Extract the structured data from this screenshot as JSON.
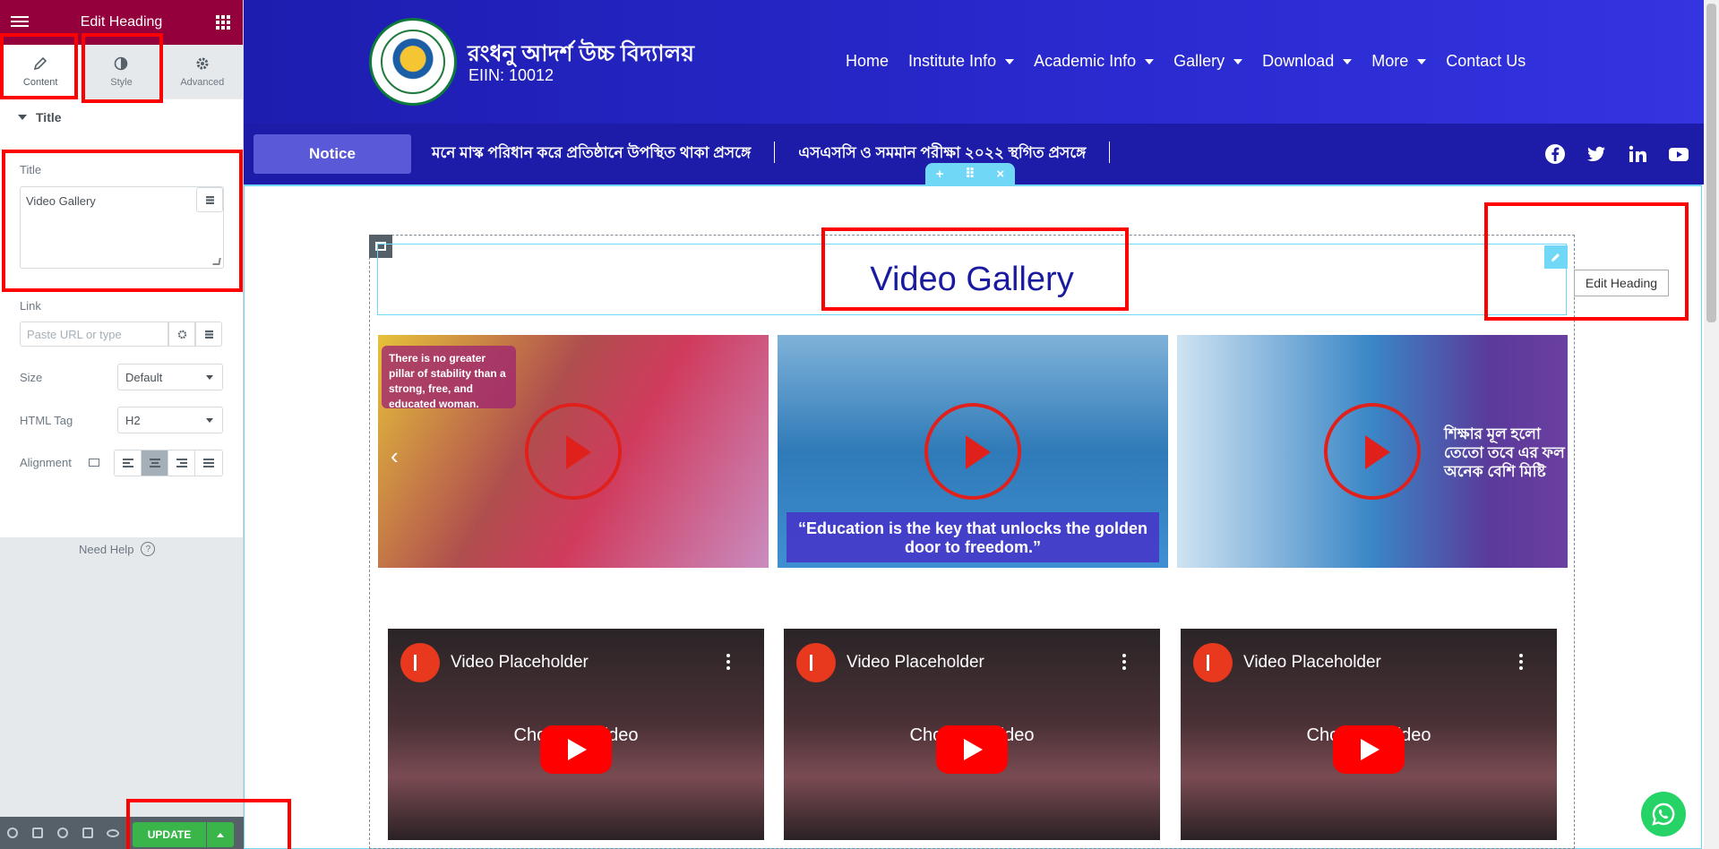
{
  "panel": {
    "header_title": "Edit Heading",
    "tabs": [
      {
        "label": "Content"
      },
      {
        "label": "Style"
      },
      {
        "label": "Advanced"
      }
    ],
    "section_title": "Title",
    "title_label": "Title",
    "title_value": "Video Gallery",
    "link_label": "Link",
    "link_placeholder": "Paste URL or type",
    "size_label": "Size",
    "size_value": "Default",
    "html_tag_label": "HTML Tag",
    "html_tag_value": "H2",
    "alignment_label": "Alignment",
    "alignment_selected": "center",
    "need_help": "Need Help",
    "update_label": "UPDATE"
  },
  "site": {
    "school_name": "রংধনু আদর্শ উচ্চ বিদ্যালয়",
    "eiin": "EIIN: 10012",
    "nav": [
      {
        "label": "Home",
        "dropdown": false
      },
      {
        "label": "Institute Info",
        "dropdown": true
      },
      {
        "label": "Academic Info",
        "dropdown": true
      },
      {
        "label": "Gallery",
        "dropdown": true
      },
      {
        "label": "Download",
        "dropdown": true
      },
      {
        "label": "More",
        "dropdown": true
      },
      {
        "label": "Contact Us",
        "dropdown": false
      }
    ],
    "notice_label": "Notice",
    "notices": [
      "মনে মাস্ক পরিধান করে প্রতিষ্ঠানে উপস্থিত থাকা প্রসঙ্গে",
      "এসএসসি ও সমমান পরীক্ষা ২০২২ স্থগিত প্রসঙ্গে"
    ],
    "social_icons": [
      "facebook-icon",
      "twitter-icon",
      "linkedin-icon",
      "youtube-icon"
    ],
    "heading": "Video Gallery",
    "edit_tooltip": "Edit Heading",
    "slides": [
      {
        "caption": "There is no greater pillar of stability than a strong, free, and educated woman."
      },
      {
        "caption": "“Education is the key that unlocks the golden door to freedom.”"
      },
      {
        "caption": "শিক্ষার মূল হলো তেতো তবে এর ফল অনেক বেশি মিষ্টি"
      }
    ],
    "videos": [
      {
        "title": "Video Placeholder",
        "overlay": "Choose a video"
      },
      {
        "title": "Video Placeholder",
        "overlay": "Choose a video"
      },
      {
        "title": "Video Placeholder",
        "overlay": "Choose a video"
      }
    ]
  },
  "colors": {
    "panel_header": "#93003c",
    "site_header": "#2a2ad0",
    "heading_text": "#1a1aa0",
    "update_button": "#39b54a",
    "annotation": "#ff0000"
  }
}
